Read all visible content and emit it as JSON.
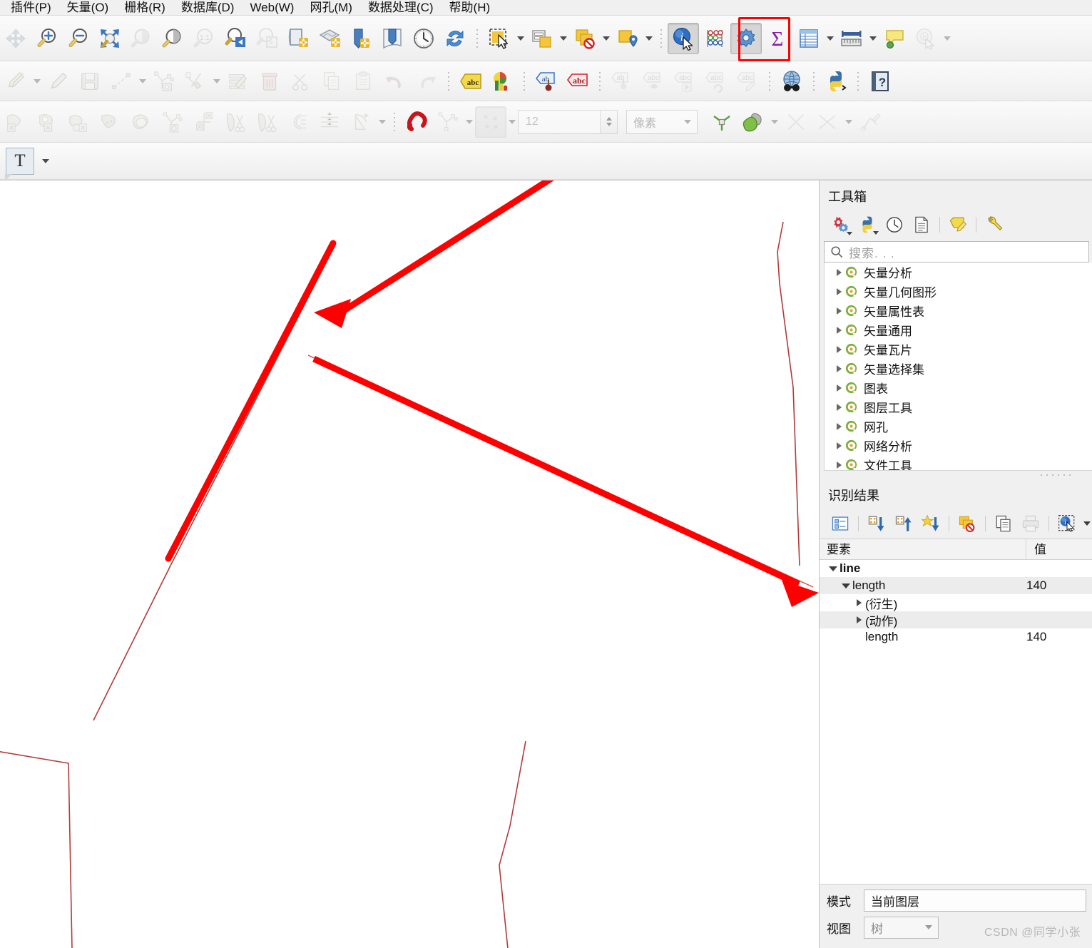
{
  "menu": {
    "items": [
      {
        "label": "插件(P)",
        "name": "menu-plugins"
      },
      {
        "label": "矢量(O)",
        "name": "menu-vector"
      },
      {
        "label": "栅格(R)",
        "name": "menu-raster"
      },
      {
        "label": "数据库(D)",
        "name": "menu-database"
      },
      {
        "label": "Web(W)",
        "name": "menu-web"
      },
      {
        "label": "网孔(M)",
        "name": "menu-mesh"
      },
      {
        "label": "数据处理(C)",
        "name": "menu-processing"
      },
      {
        "label": "帮助(H)",
        "name": "menu-help"
      }
    ]
  },
  "toolbar_row3": {
    "spin_value": "12",
    "units_value": "像素"
  },
  "toolbox": {
    "title": "工具箱",
    "search_placeholder": "搜索. . .",
    "items": [
      {
        "label": "矢量分析"
      },
      {
        "label": "矢量几何图形"
      },
      {
        "label": "矢量属性表"
      },
      {
        "label": "矢量通用"
      },
      {
        "label": "矢量瓦片"
      },
      {
        "label": "矢量选择集"
      },
      {
        "label": "图表"
      },
      {
        "label": "图层工具"
      },
      {
        "label": "网孔"
      },
      {
        "label": "网络分析"
      },
      {
        "label": "文件工具"
      }
    ]
  },
  "identify": {
    "title": "识别结果",
    "columns": {
      "feature": "要素",
      "value": "值"
    },
    "rows": [
      {
        "label": "line",
        "value": "",
        "indent": 0,
        "expander": "down",
        "bold": true,
        "shade": false
      },
      {
        "label": "length",
        "value": "140",
        "indent": 1,
        "expander": "down",
        "bold": false,
        "shade": true
      },
      {
        "label": "(衍生)",
        "value": "",
        "indent": 2,
        "expander": "right",
        "bold": false,
        "shade": false
      },
      {
        "label": "(动作)",
        "value": "",
        "indent": 2,
        "expander": "right",
        "bold": false,
        "shade": true
      },
      {
        "label": "length",
        "value": "140",
        "indent": 2,
        "expander": "none",
        "bold": false,
        "shade": false
      }
    ],
    "mode_label": "模式",
    "mode_value": "当前图层",
    "view_label": "视图",
    "view_value": "树"
  },
  "watermark": "CSDN @同学小张",
  "colors": {
    "annotation_red": "#ff0000",
    "vector_line": "#b33a3a",
    "accent_blue": "#3a76c4",
    "qgis_green": "#6fae3c"
  }
}
